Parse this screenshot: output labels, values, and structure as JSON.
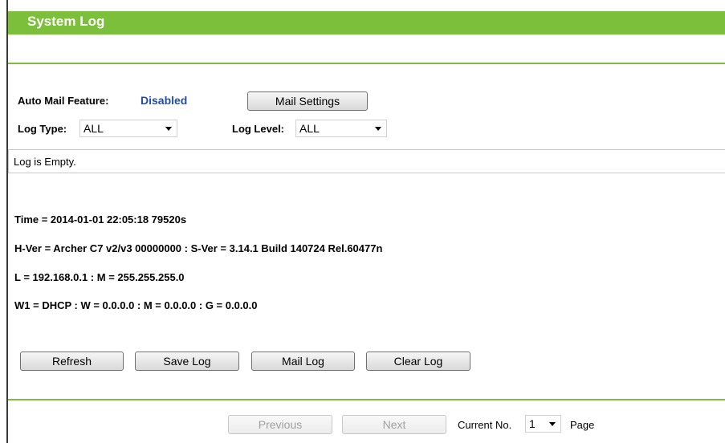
{
  "header": {
    "title": "System Log"
  },
  "mail": {
    "label": "Auto Mail Feature:",
    "status": "Disabled",
    "settings_button": "Mail Settings"
  },
  "filters": {
    "log_type_label": "Log Type:",
    "log_type_value": "ALL",
    "log_level_label": "Log Level:",
    "log_level_value": "ALL"
  },
  "log": {
    "message": "Log is Empty."
  },
  "info": {
    "time": "Time = 2014-01-01 22:05:18 79520s",
    "version": "H-Ver = Archer C7 v2/v3 00000000 : S-Ver = 3.14.1 Build 140724 Rel.60477n",
    "lan": "L = 192.168.0.1 : M = 255.255.255.0",
    "wan": "W1 = DHCP : W = 0.0.0.0 : M = 0.0.0.0 : G = 0.0.0.0"
  },
  "actions": {
    "refresh": "Refresh",
    "save_log": "Save Log",
    "mail_log": "Mail Log",
    "clear_log": "Clear Log"
  },
  "pager": {
    "previous": "Previous",
    "next": "Next",
    "current_label": "Current No.",
    "current_value": "1",
    "page_label": "Page"
  },
  "colors": {
    "accent": "#7cbf3a",
    "status_blue": "#1d4ea8"
  }
}
